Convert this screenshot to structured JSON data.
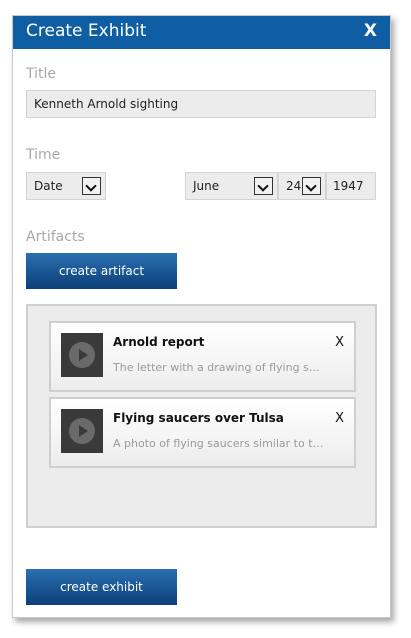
{
  "dialog": {
    "title": "Create Exhibit",
    "close_label": "X"
  },
  "title_section": {
    "label": "Title",
    "value": "Kenneth Arnold sighting"
  },
  "time_section": {
    "label": "Time",
    "type_select": "Date",
    "month_select": "June",
    "day_select": "24",
    "year": "1947"
  },
  "artifacts_section": {
    "label": "Artifacts",
    "create_artifact_label": "create artifact",
    "items": [
      {
        "title": "Arnold report",
        "description": "The letter with a drawing of flying saucers",
        "remove_label": "X"
      },
      {
        "title": "Flying saucers over Tulsa",
        "description": "A photo of flying saucers similar to those",
        "remove_label": "X"
      }
    ]
  },
  "footer": {
    "create_exhibit_label": "create exhibit"
  },
  "colors": {
    "accent": "#0f5ea3",
    "button_top": "#2a6fb0",
    "button_bottom": "#0c3f78",
    "field_bg": "#ececec",
    "label_gray": "#a8a8a8"
  }
}
